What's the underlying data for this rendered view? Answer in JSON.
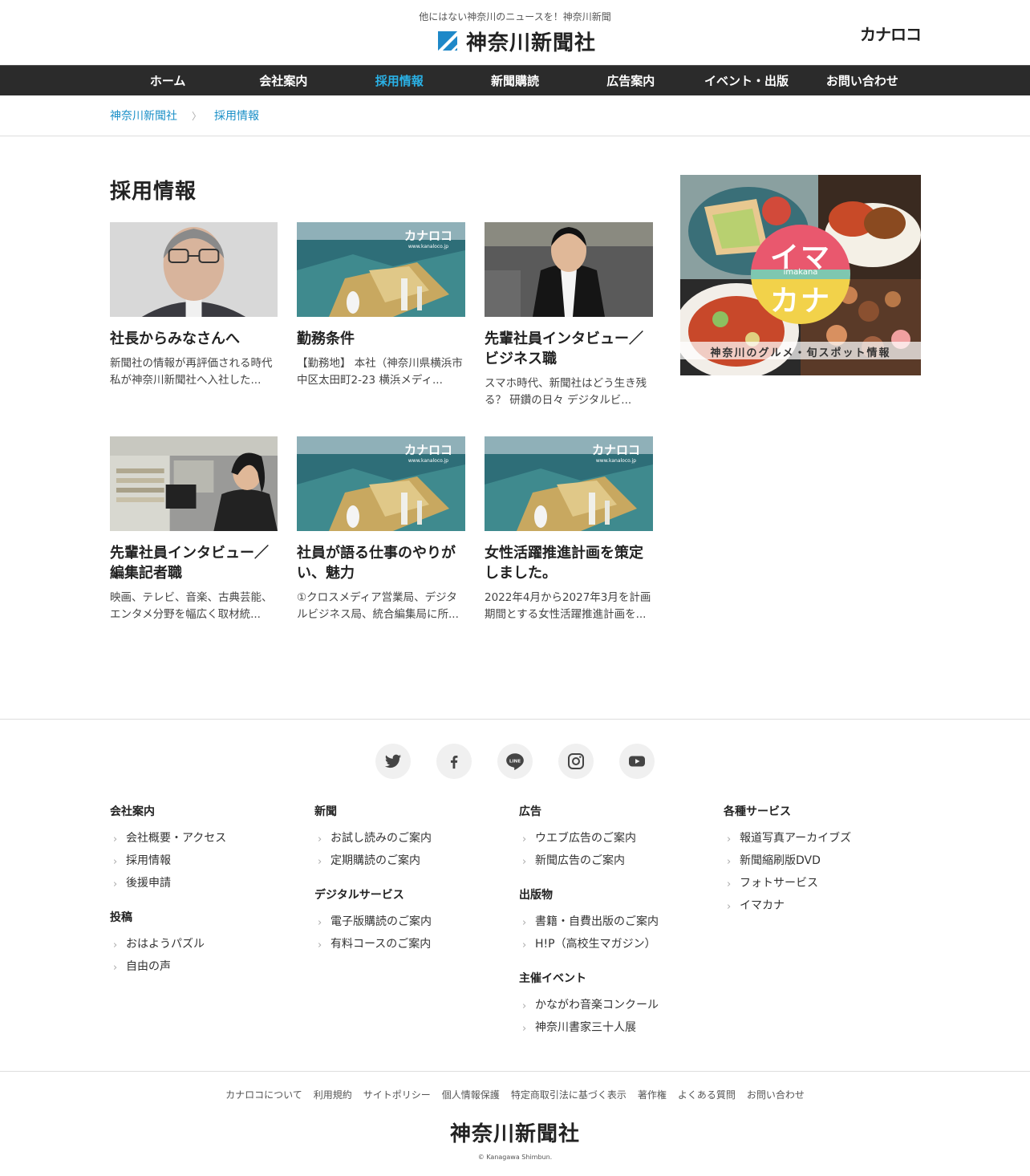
{
  "header": {
    "tagline": "他にはない神奈川のニュースを！神奈川新聞",
    "logo_text": "神奈川新聞社",
    "kanaloco": "カナロコ"
  },
  "nav": {
    "items": [
      {
        "label": "ホーム"
      },
      {
        "label": "会社案内"
      },
      {
        "label": "採用情報",
        "active": true
      },
      {
        "label": "新聞購読"
      },
      {
        "label": "広告案内"
      },
      {
        "label": "イベント・出版"
      },
      {
        "label": "お問い合わせ"
      }
    ]
  },
  "breadcrumb": {
    "home": "神奈川新聞社",
    "current": "採用情報"
  },
  "main": {
    "title": "採用情報",
    "cards": [
      {
        "title": "社長からみなさんへ",
        "desc": "新聞社の情報が再評価される時代 私が神奈川新聞社へ入社した..."
      },
      {
        "title": "勤務条件",
        "desc": "【勤務地】 本社（神奈川県横浜市中区太田町2-23 横浜メディ..."
      },
      {
        "title": "先輩社員インタビュー／ビジネス職",
        "desc": "スマホ時代、新聞社はどう生き残る？ 研鑽の日々 デジタルビ..."
      },
      {
        "title": "先輩社員インタビュー／編集記者職",
        "desc": "映画、テレビ、音楽、古典芸能、エンタメ分野を幅広く取材統..."
      },
      {
        "title": "社員が語る仕事のやりがい、魅力",
        "desc": "①クロスメディア営業局、デジタルビジネス局、統合編集局に所..."
      },
      {
        "title": "女性活躍推進計画を策定しました。",
        "desc": "2022年4月から2027年3月を計画期間とする女性活躍推進計画を..."
      }
    ],
    "thumb_watermark": "カナロコ",
    "thumb_url": "www.kanaloco.jp"
  },
  "banner": {
    "title_top": "イマ",
    "title_bottom": "カナ",
    "sub": "imakana",
    "caption": "神奈川のグルメ・旬スポット情報"
  },
  "footer": {
    "columns": [
      [
        {
          "heading": "会社案内",
          "items": [
            "会社概要・アクセス",
            "採用情報",
            "後援申請"
          ]
        },
        {
          "heading": "投稿",
          "items": [
            "おはようパズル",
            "自由の声"
          ]
        }
      ],
      [
        {
          "heading": "新聞",
          "items": [
            "お試し読みのご案内",
            "定期購読のご案内"
          ]
        },
        {
          "heading": "デジタルサービス",
          "items": [
            "電子版購読のご案内",
            "有料コースのご案内"
          ]
        }
      ],
      [
        {
          "heading": "広告",
          "items": [
            "ウエブ広告のご案内",
            "新聞広告のご案内"
          ]
        },
        {
          "heading": "出版物",
          "items": [
            "書籍・自費出版のご案内",
            "H!P（高校生マガジン）"
          ]
        },
        {
          "heading": "主催イベント",
          "items": [
            "かながわ音楽コンクール",
            "神奈川書家三十人展"
          ]
        }
      ],
      [
        {
          "heading": "各種サービス",
          "items": [
            "報道写真アーカイブズ",
            "新聞縮刷版DVD",
            "フォトサービス",
            "イマカナ"
          ]
        }
      ]
    ],
    "bottom_links": [
      "カナロコについて",
      "利用規約",
      "サイトポリシー",
      "個人情報保護",
      "特定商取引法に基づく表示",
      "著作権",
      "よくある質問",
      "お問い合わせ"
    ],
    "logo_text": "神奈川新聞社",
    "copyright": "© Kanagawa Shimbun."
  }
}
